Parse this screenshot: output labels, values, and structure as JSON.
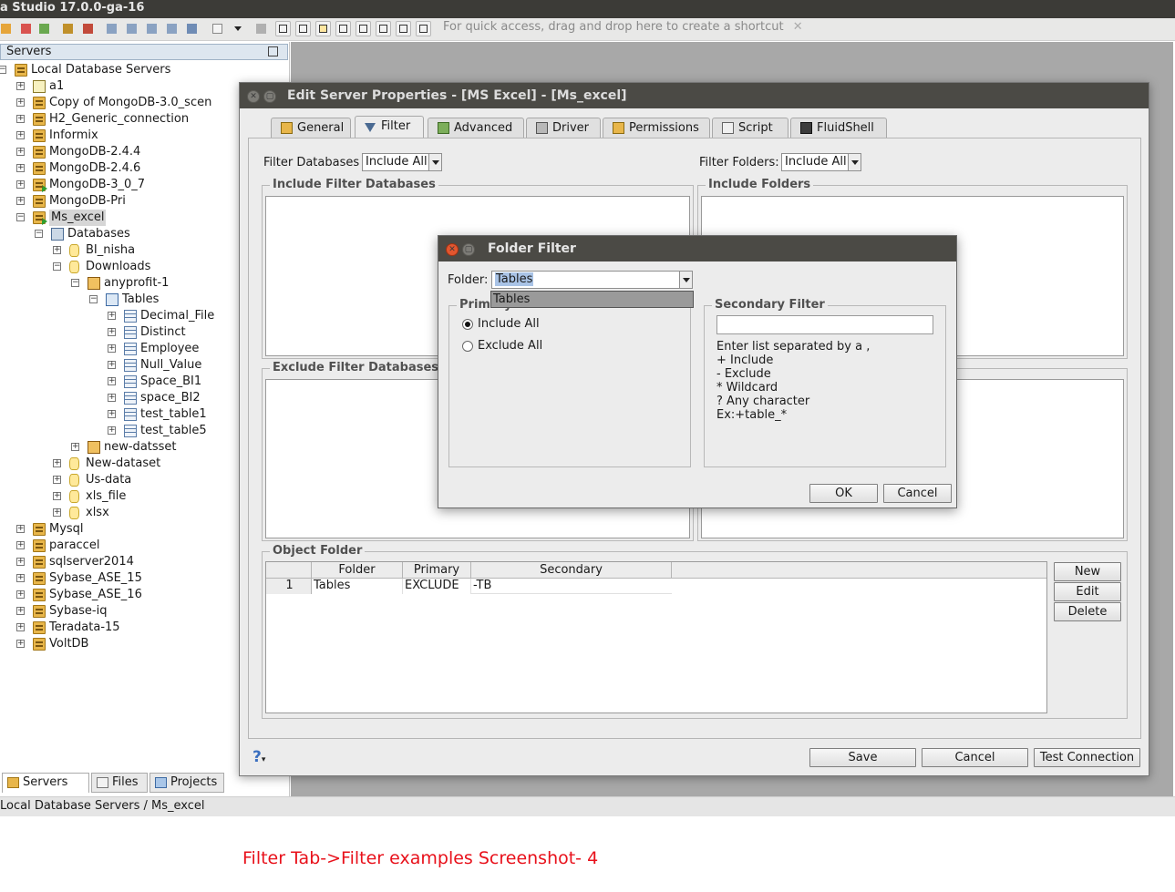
{
  "app": {
    "title": "a Studio 17.0.0-ga-16",
    "shortcut_hint": "For quick access, drag and drop here to create a shortcut",
    "shortcut_close": "✕",
    "status_path": "Local Database Servers / Ms_excel",
    "caption": "Filter Tab->Filter examples Screenshot- 4"
  },
  "servers_panel": {
    "title": "Servers",
    "tree": [
      {
        "label": "Local Database Servers",
        "depth": 0,
        "icon": "server-group",
        "expander": "minus"
      },
      {
        "label": "a1",
        "depth": 1,
        "icon": "folder",
        "expander": "plus"
      },
      {
        "label": "Copy of MongoDB-3.0_scen",
        "depth": 1,
        "icon": "server",
        "expander": "plus"
      },
      {
        "label": "H2_Generic_connection",
        "depth": 1,
        "icon": "server",
        "expander": "plus"
      },
      {
        "label": "Informix",
        "depth": 1,
        "icon": "server",
        "expander": "plus"
      },
      {
        "label": "MongoDB-2.4.4",
        "depth": 1,
        "icon": "server",
        "expander": "plus"
      },
      {
        "label": "MongoDB-2.4.6",
        "depth": 1,
        "icon": "server",
        "expander": "plus"
      },
      {
        "label": "MongoDB-3_0_7",
        "depth": 1,
        "icon": "server-connected",
        "expander": "plus"
      },
      {
        "label": "MongoDB-Pri",
        "depth": 1,
        "icon": "server",
        "expander": "plus"
      },
      {
        "label": "Ms_excel",
        "depth": 1,
        "icon": "server-connected",
        "expander": "minus",
        "selected": true
      },
      {
        "label": "Databases",
        "depth": 2,
        "icon": "databases",
        "expander": "minus"
      },
      {
        "label": "BI_nisha",
        "depth": 3,
        "icon": "database",
        "expander": "plus"
      },
      {
        "label": "Downloads",
        "depth": 3,
        "icon": "database",
        "expander": "minus"
      },
      {
        "label": "anyprofit-1",
        "depth": 4,
        "icon": "schema",
        "expander": "minus"
      },
      {
        "label": "Tables",
        "depth": 5,
        "icon": "folder-blue",
        "expander": "minus"
      },
      {
        "label": "Decimal_File",
        "depth": 6,
        "icon": "table",
        "expander": "plus"
      },
      {
        "label": "Distinct",
        "depth": 6,
        "icon": "table",
        "expander": "plus"
      },
      {
        "label": "Employee",
        "depth": 6,
        "icon": "table",
        "expander": "plus"
      },
      {
        "label": "Null_Value",
        "depth": 6,
        "icon": "table",
        "expander": "plus"
      },
      {
        "label": "Space_BI1",
        "depth": 6,
        "icon": "table",
        "expander": "plus"
      },
      {
        "label": "space_BI2",
        "depth": 6,
        "icon": "table",
        "expander": "plus"
      },
      {
        "label": "test_table1",
        "depth": 6,
        "icon": "table",
        "expander": "plus"
      },
      {
        "label": "test_table5",
        "depth": 6,
        "icon": "table",
        "expander": "plus"
      },
      {
        "label": "new-datsset",
        "depth": 4,
        "icon": "schema",
        "expander": "plus"
      },
      {
        "label": "New-dataset",
        "depth": 3,
        "icon": "database",
        "expander": "plus"
      },
      {
        "label": "Us-data",
        "depth": 3,
        "icon": "database",
        "expander": "plus"
      },
      {
        "label": "xls_file",
        "depth": 3,
        "icon": "database",
        "expander": "plus"
      },
      {
        "label": "xlsx",
        "depth": 3,
        "icon": "database",
        "expander": "plus"
      },
      {
        "label": "Mysql",
        "depth": 1,
        "icon": "server",
        "expander": "plus"
      },
      {
        "label": "paraccel",
        "depth": 1,
        "icon": "server",
        "expander": "plus"
      },
      {
        "label": "sqlserver2014",
        "depth": 1,
        "icon": "server",
        "expander": "plus"
      },
      {
        "label": "Sybase_ASE_15",
        "depth": 1,
        "icon": "server",
        "expander": "plus"
      },
      {
        "label": "Sybase_ASE_16",
        "depth": 1,
        "icon": "server",
        "expander": "plus"
      },
      {
        "label": "Sybase-iq",
        "depth": 1,
        "icon": "server",
        "expander": "plus"
      },
      {
        "label": "Teradata-15",
        "depth": 1,
        "icon": "server",
        "expander": "plus"
      },
      {
        "label": "VoltDB",
        "depth": 1,
        "icon": "server",
        "expander": "plus"
      }
    ],
    "bottom_tabs": [
      {
        "label": "Servers",
        "icon": "servers-icon",
        "active": true
      },
      {
        "label": "Files",
        "icon": "files-icon",
        "active": false
      },
      {
        "label": "Projects",
        "icon": "projects-icon",
        "active": false
      }
    ]
  },
  "edit_server": {
    "title": "Edit Server Properties - [MS Excel] - [Ms_excel]",
    "tabs": [
      {
        "label": "General",
        "icon": "pencil-icon"
      },
      {
        "label": "Filter",
        "icon": "filter-icon",
        "active": true
      },
      {
        "label": "Advanced",
        "icon": "advanced-icon"
      },
      {
        "label": "Driver",
        "icon": "driver-icon"
      },
      {
        "label": "Permissions",
        "icon": "permissions-icon"
      },
      {
        "label": "Script",
        "icon": "script-icon"
      },
      {
        "label": "FluidShell",
        "icon": "shell-icon"
      }
    ],
    "filter_databases_label": "Filter Databases",
    "filter_databases_value": "Include All",
    "filter_folders_label": "Filter Folders:",
    "filter_folders_value": "Include All",
    "include_filter_databases": "Include Filter Databases",
    "include_folders": "Include Folders",
    "exclude_filter_databases": "Exclude Filter Databases",
    "object_folder": {
      "title": "Object Folder",
      "columns": [
        "Folder",
        "Primary",
        "Secondary"
      ],
      "rows": [
        {
          "num": "1",
          "folder": "Tables",
          "primary": "EXCLUDE",
          "secondary": "-TB"
        }
      ],
      "buttons": {
        "new": "New",
        "edit": "Edit",
        "delete": "Delete"
      }
    },
    "help": "?",
    "buttons": {
      "save": "Save",
      "cancel": "Cancel",
      "test": "Test Connection"
    }
  },
  "folder_filter": {
    "title": "Folder Filter",
    "folder_label": "Folder:",
    "folder_value": "Tables",
    "dropdown_options": [
      "Tables"
    ],
    "primary_title": "Primary Filter",
    "include_all": "Include All",
    "exclude_all": "Exclude All",
    "primary_selected": "include_all",
    "secondary_title": "Secondary Filter",
    "secondary_value": "",
    "help_lines": [
      "Enter list separated by a ,",
      "+ Include",
      "- Exclude",
      "* Wildcard",
      "? Any character",
      "Ex:+table_*"
    ],
    "ok": "OK",
    "cancel": "Cancel"
  }
}
